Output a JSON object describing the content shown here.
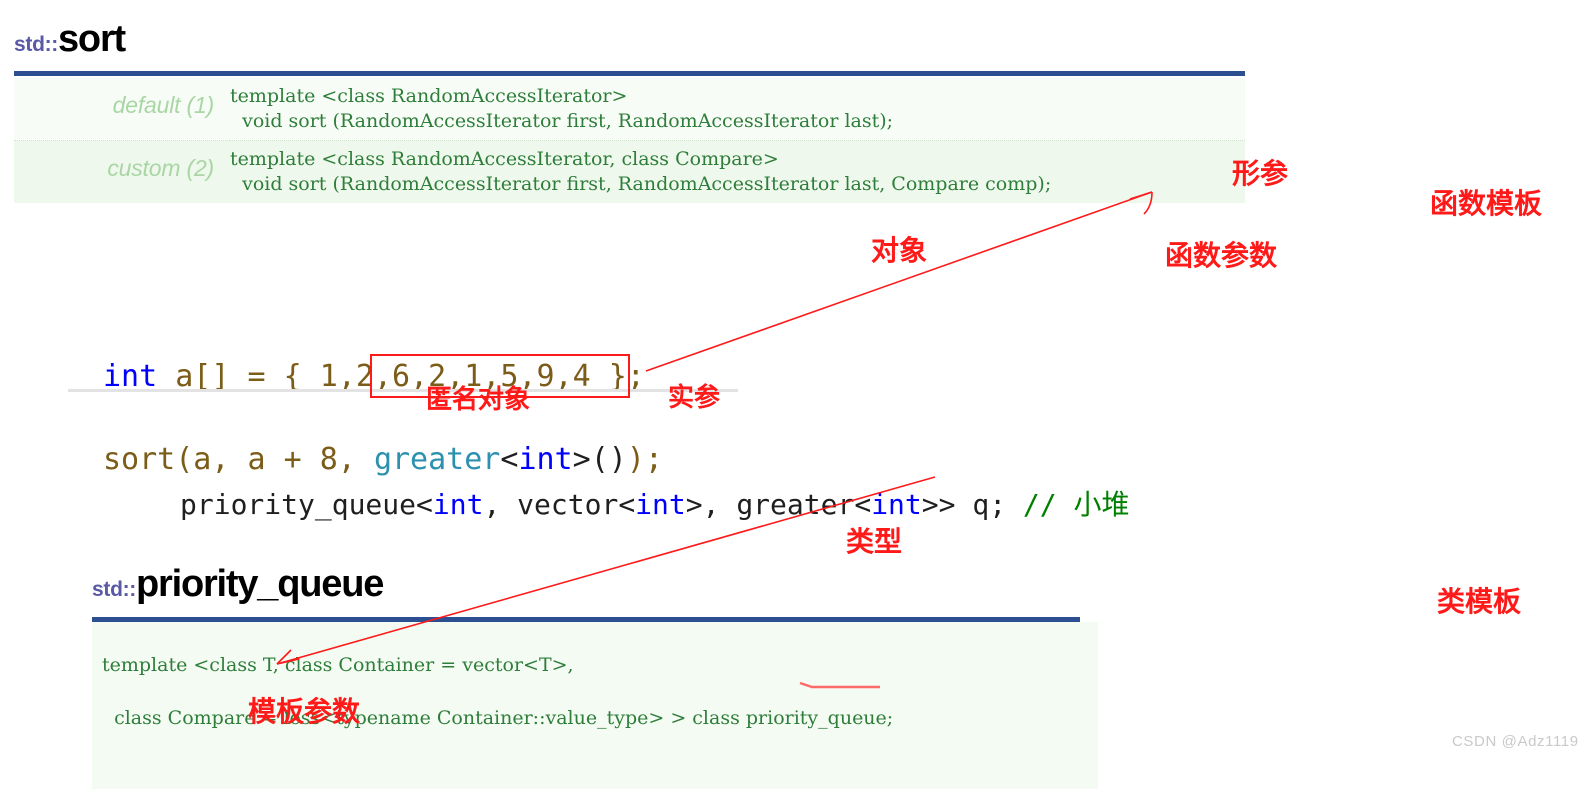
{
  "sort_section": {
    "heading_ns": "std::",
    "heading_name": "sort",
    "rows": [
      {
        "label": "default (1)",
        "line1": "template <class RandomAccessIterator>",
        "line2": "  void sort (RandomAccessIterator first, RandomAccessIterator last);"
      },
      {
        "label": "custom (2)",
        "line1": "template <class RandomAccessIterator, class Compare>",
        "line2": "  void sort (RandomAccessIterator first, RandomAccessIterator last, Compare comp);"
      }
    ]
  },
  "code_sort": {
    "line1_kw": "int",
    "line1_rest": " a[] = { 1,2,6,2,1,5,9,4 };",
    "line2_a": "sort(a, a + 8, ",
    "line2_greater": "greater",
    "line2_lt": "<",
    "line2_int": "int",
    "line2_gt": ">",
    "line2_parens": "()",
    "line2_end": ");"
  },
  "code_pq": {
    "p1": "priority_queue<",
    "int1": "int",
    "p2": ", vector<",
    "int2": "int",
    "p3": ">, greater<",
    "int3": "int",
    "p4": ">> q; ",
    "comment": "// 小堆"
  },
  "pq_section": {
    "heading_ns": "std::",
    "heading_name": "priority_queue",
    "line1": "template <class T, class Container = vector<T>,",
    "line2": "  class Compare = less<typename Container::value_type> > class priority_queue;"
  },
  "annotations": {
    "xingcan": "形参",
    "hanshu_mouban": "函数模板",
    "duixiang": "对象",
    "hanshu_canshu": "函数参数",
    "mingming_duixiang": "匿名对象",
    "shican": "实参",
    "leixing": "类型",
    "lei_mouban": "类模板",
    "mouban_canshu": "模板参数"
  },
  "watermark": "CSDN @Adz1119",
  "colors": {
    "annotation_red": "#ff1a1a",
    "heading_ns_purple": "#5a59a5",
    "rule_blue": "#2b4f91",
    "code_green": "#2e7d3a",
    "label_green": "#a9d6a4",
    "keyword_blue": "#0000ff",
    "comment_green": "#008000",
    "type_teal": "#2b91af",
    "watermark_gray": "#c9c9c9"
  }
}
